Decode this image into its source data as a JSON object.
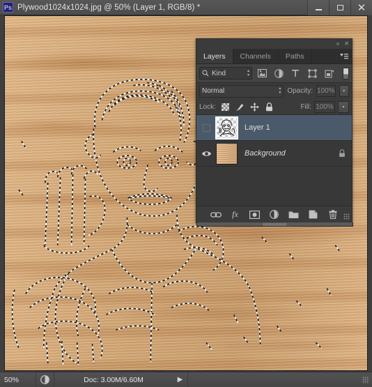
{
  "window": {
    "app_icon": "photoshop-logo-icon",
    "title": "Plywood1024x1024.jpg @ 50% (Layer 1, RGB/8) *",
    "minimize_label": "–",
    "maximize_label": "□",
    "close_label": "✕"
  },
  "canvas": {
    "document_name": "Plywood1024x1024.jpg",
    "zoom": "50%",
    "background_color": "#d2a775",
    "selection_description": "marching-ants selection outline of a portrait sketch"
  },
  "panel": {
    "collapse_label": "«",
    "close_label": "✕",
    "menu_label": "▾≡",
    "tabs": [
      {
        "label": "Layers",
        "active": true
      },
      {
        "label": "Channels",
        "active": false
      },
      {
        "label": "Paths",
        "active": false
      }
    ],
    "filter": {
      "search_icon": "magnifier-icon",
      "kind_label": "Kind",
      "spinner_up": "▴",
      "spinner_down": "▾",
      "icons": [
        "pixel-layer-filter-icon",
        "adjustment-layer-filter-icon",
        "type-layer-filter-icon",
        "shape-layer-filter-icon",
        "smart-object-filter-icon"
      ],
      "toggle_name": "filter-enable-toggle"
    },
    "blend": {
      "mode": "Normal",
      "mode_arrow": "⇅",
      "opacity_label": "Opacity:",
      "opacity_value": "100%",
      "dropdown_arrow": "▾"
    },
    "lock": {
      "label": "Lock:",
      "icons": [
        "lock-transparent-pixels-icon",
        "lock-image-pixels-icon",
        "lock-position-icon",
        "lock-all-icon"
      ],
      "fill_label": "Fill:",
      "fill_value": "100%",
      "dropdown_arrow": "▾"
    },
    "layers": [
      {
        "name": "Layer 1",
        "visible": false,
        "selected": true,
        "italic": false,
        "locked": false,
        "thumbnail": "transparent-sketch-thumbnail"
      },
      {
        "name": "Background",
        "visible": true,
        "selected": false,
        "italic": true,
        "locked": true,
        "thumbnail": "wood-texture-thumbnail"
      }
    ],
    "footer_icons": [
      "link-layers-icon",
      "layer-style-fx-icon",
      "add-layer-mask-icon",
      "new-adjustment-layer-icon",
      "new-group-icon",
      "new-layer-icon",
      "delete-layer-icon"
    ],
    "fx_label": "fx"
  },
  "statusbar": {
    "zoom_value": "50%",
    "doc_icon": "document-thumb-icon",
    "doc_info": "Doc: 3.00M/6.60M",
    "play_label": "▶"
  }
}
